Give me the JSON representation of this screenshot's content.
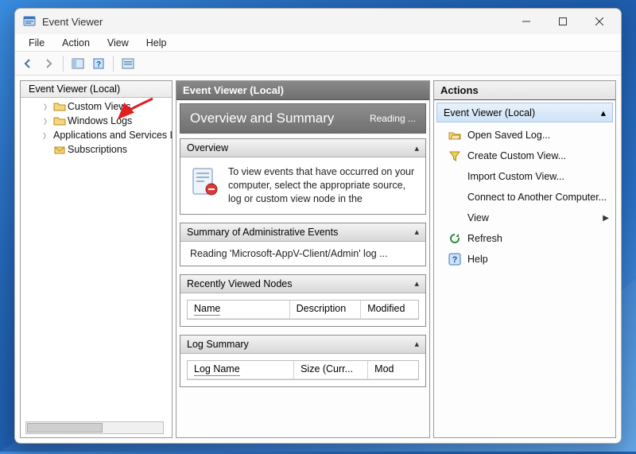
{
  "window": {
    "title": "Event Viewer"
  },
  "menubar": [
    "File",
    "Action",
    "View",
    "Help"
  ],
  "tree": {
    "root_label": "Event Viewer (Local)",
    "items": [
      {
        "label": "Custom Views",
        "expandable": true
      },
      {
        "label": "Windows Logs",
        "expandable": true
      },
      {
        "label": "Applications and Services Logs",
        "expandable": true
      },
      {
        "label": "Subscriptions",
        "expandable": false
      }
    ]
  },
  "center": {
    "header": "Event Viewer (Local)",
    "overview_title": "Overview and Summary",
    "overview_status": "Reading ...",
    "sections": {
      "overview": {
        "title": "Overview",
        "text": "To view events that have occurred on your computer, select the appropriate source, log or custom view node in the"
      },
      "admin_summary": {
        "title": "Summary of Administrative Events",
        "text": "Reading 'Microsoft-AppV-Client/Admin' log ..."
      },
      "recent_nodes": {
        "title": "Recently Viewed Nodes",
        "cols": [
          "Name",
          "Description",
          "Modified"
        ]
      },
      "log_summary": {
        "title": "Log Summary",
        "cols": [
          "Log Name",
          "Size (Curr...",
          "Mod"
        ]
      }
    }
  },
  "actions": {
    "panel_title": "Actions",
    "group_title": "Event Viewer (Local)",
    "items": [
      {
        "icon": "folder-open-icon",
        "label": "Open Saved Log..."
      },
      {
        "icon": "funnel-icon",
        "label": "Create Custom View..."
      },
      {
        "icon": "blank-icon",
        "label": "Import Custom View..."
      },
      {
        "icon": "blank-icon",
        "label": "Connect to Another Computer..."
      },
      {
        "icon": "blank-icon",
        "label": "View",
        "submenu": true
      },
      {
        "icon": "refresh-icon",
        "label": "Refresh"
      },
      {
        "icon": "help-icon",
        "label": "Help"
      }
    ]
  }
}
